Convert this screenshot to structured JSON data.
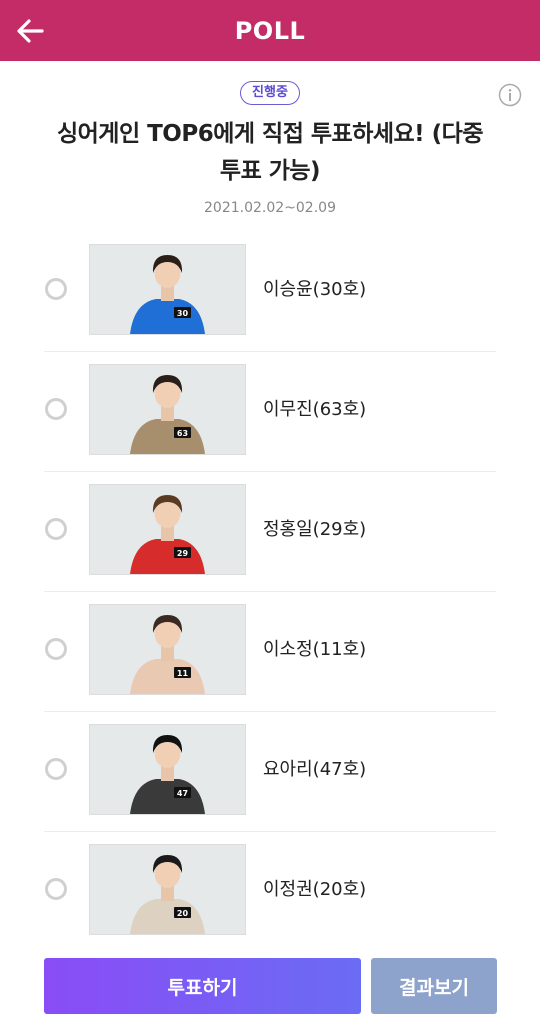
{
  "header": {
    "title": "POLL"
  },
  "poll": {
    "status": "진행중",
    "title_line1": "싱어게인 TOP6에게 직접 투표하세요! (다중",
    "title_line2": "투표 가능)",
    "period": "2021.02.02~02.09"
  },
  "options": [
    {
      "name": "이승윤(30호)",
      "tag": "30",
      "jacket": "#1f6fd6",
      "hair": "#2a1f18"
    },
    {
      "name": "이무진(63호)",
      "tag": "63",
      "jacket": "#a78f6e",
      "hair": "#2a1f18"
    },
    {
      "name": "정홍일(29호)",
      "tag": "29",
      "jacket": "#d72c2c",
      "hair": "#5a3a22"
    },
    {
      "name": "이소정(11호)",
      "tag": "11",
      "jacket": "#e9c9b1",
      "hair": "#3a2a22"
    },
    {
      "name": "요아리(47호)",
      "tag": "47",
      "jacket": "#3a3a3a",
      "hair": "#111111"
    },
    {
      "name": "이정권(20호)",
      "tag": "20",
      "jacket": "#ddd2c2",
      "hair": "#1a1a1a"
    }
  ],
  "buttons": {
    "vote": "투표하기",
    "result": "결과보기"
  },
  "colors": {
    "header": "#c42c68",
    "accent": "#6b5bd6",
    "vote_button": "#7a5cf5",
    "result_button": "#8ea3cc"
  }
}
